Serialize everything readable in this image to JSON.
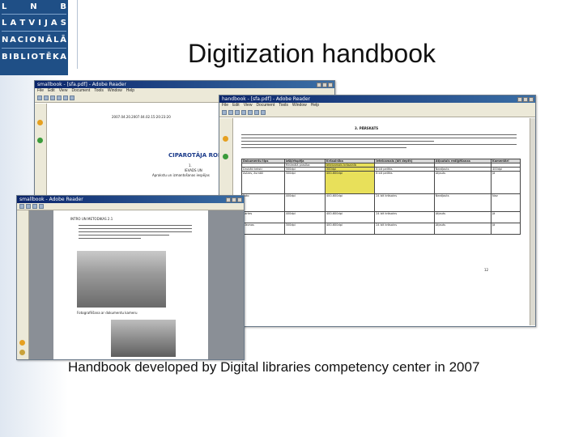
{
  "logo": {
    "rows": [
      [
        "L",
        "N",
        "B"
      ],
      [
        "L",
        "A",
        "T",
        "V",
        "I",
        "J",
        "A",
        "S"
      ],
      [
        "N",
        "A",
        "C",
        "I",
        "O",
        "N",
        "Ā",
        "L",
        "Ā"
      ],
      [
        "B",
        "I",
        "B",
        "L",
        "I",
        "O",
        "T",
        "Ē",
        "K",
        "A"
      ]
    ]
  },
  "slide": {
    "title": "Digitization handbook",
    "caption": "Handbook developed by Digital libraries competency center in 2007"
  },
  "windows": {
    "back": {
      "title": "smallbook - [sfa.pdf] - Adobe Reader",
      "menus": [
        "File",
        "Edit",
        "View",
        "Document",
        "Tools",
        "Window",
        "Help"
      ],
      "doc_date": "2007.04.20.2007.04.02.15:20:23:20",
      "doc_heading": "CIPAROTĀJA ROKASGRĀMATA",
      "doc_sub": "1.",
      "doc_sub2": "IEVADS UN",
      "doc_sub3": "Aprakstu un izmantošanas iespējas"
    },
    "front_right": {
      "title": "handbook - [sfa.pdf] - Adobe Reader",
      "menus": [
        "File",
        "Edit",
        "View",
        "Document",
        "Tools",
        "Window",
        "Help"
      ],
      "section": "3. PĀRSKATS",
      "page_num": "12",
      "table": {
        "headers": [
          "Dokumentu tips",
          "Izšķirtspēja",
          "Krāsainība",
          "Ieteicamais (bit depth)",
          "Atļautais rediģēšanas",
          "Komentāri"
        ],
        "subheaders": [
          "",
          "Minimālā prasība",
          "Ieteicamais krāsainīb",
          "",
          "",
          ""
        ],
        "rows": [
          [
            "Drukāti teksti",
            "300dpi",
            "300dpi",
            "8 bit pelēks",
            "Neatļauts",
            "400dpi"
          ],
          [
            "Avīzes, žurnāli",
            "300dpi",
            "400-600dpi",
            "8 bit pelēks",
            "Atļauts",
            "Jā"
          ],
          [
            "Foto",
            "400dpi",
            "400-600dpi",
            "24 bit krāsains",
            "Neatļauts",
            "Nav"
          ],
          [
            "Kartes",
            "400dpi",
            "400-600dpi",
            "24 bit krāsains",
            "Atļauts",
            "Jā"
          ],
          [
            "Gleznas",
            "300dpi",
            "400-600dpi",
            "24 bit krāsains",
            "Atļauts",
            "Jā"
          ]
        ]
      }
    },
    "front_left": {
      "title": "smallbook - Adobe Reader",
      "photo_caption": "Fotografēšana ar dokumentu kameru",
      "section": "INTRO UN METODIKAS 2.1"
    }
  }
}
